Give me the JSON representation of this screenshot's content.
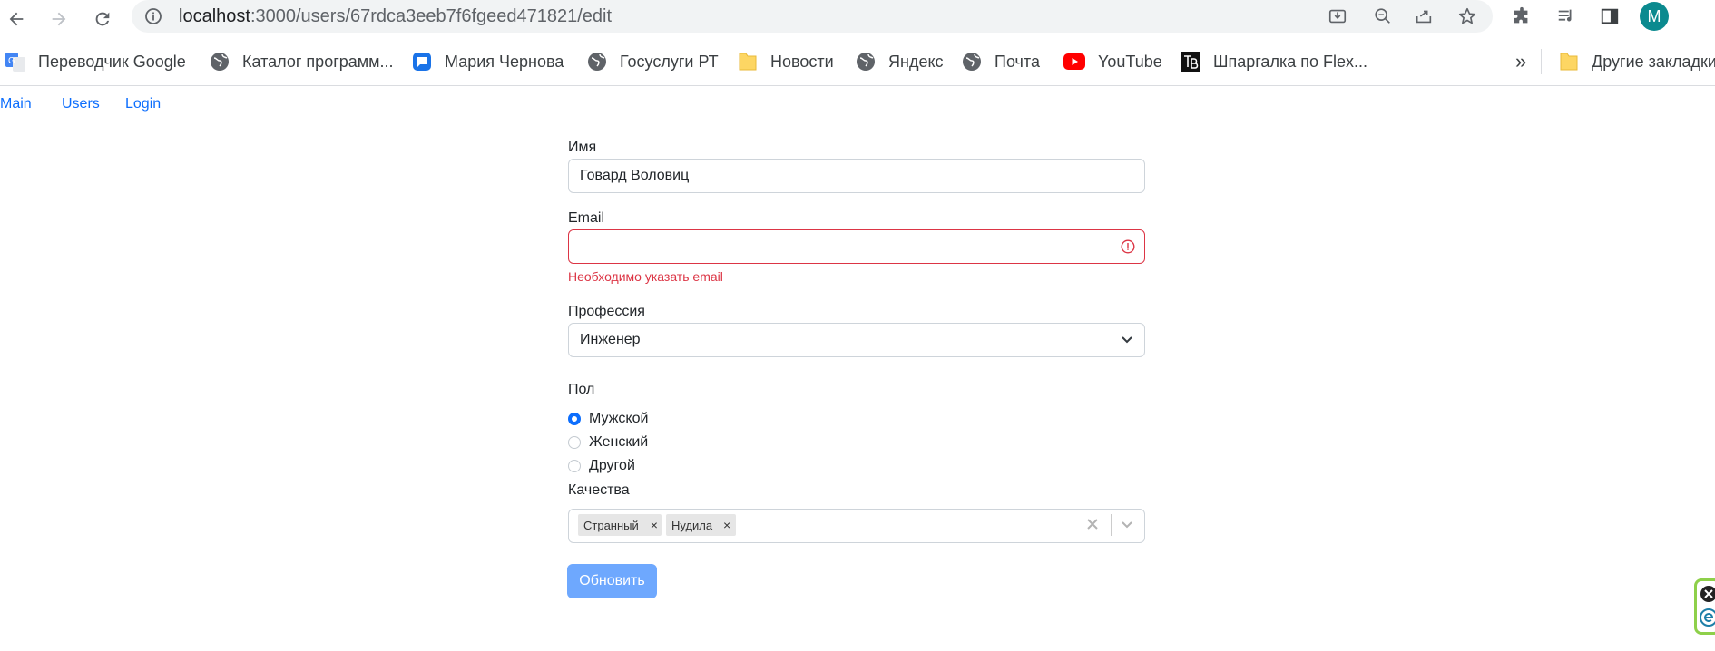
{
  "browser": {
    "url_host": "localhost",
    "url_path": ":3000/users/67rdca3eeb7f6fgeed471821/edit",
    "avatar_letter": "M"
  },
  "bookmarks": {
    "items": [
      {
        "label": "Переводчик Google",
        "icon": "google-translate-icon"
      },
      {
        "label": "Каталог программ...",
        "icon": "globe-icon"
      },
      {
        "label": "Мария Чернова",
        "icon": "chat-icon"
      },
      {
        "label": "Госуслуги РТ",
        "icon": "globe-icon"
      },
      {
        "label": "Новости",
        "icon": "folder-icon"
      },
      {
        "label": "Яндекс",
        "icon": "globe-icon"
      },
      {
        "label": "Почта",
        "icon": "globe-icon"
      },
      {
        "label": "YouTube",
        "icon": "youtube-icon"
      },
      {
        "label": "Шпаргалка по Flex...",
        "icon": "tb-icon"
      }
    ],
    "overflow": "»",
    "other_bookmarks": "Другие закладки"
  },
  "nav": {
    "main": "Main",
    "users": "Users",
    "login": "Login"
  },
  "form": {
    "name_label": "Имя",
    "name_value": "Говард Воловиц",
    "email_label": "Email",
    "email_value": "",
    "email_error": "Необходимо указать email",
    "profession_label": "Профессия",
    "profession_value": "Инженер",
    "sex_label": "Пол",
    "sex_options": [
      "Мужской",
      "Женский",
      "Другой"
    ],
    "sex_selected": "Мужской",
    "qualities_label": "Качества",
    "qualities": [
      "Странный",
      "Нудила"
    ],
    "chip_remove": "×",
    "submit_label": "Обновить"
  },
  "colors": {
    "accent": "#0d6efd",
    "button": "#6ea8fe",
    "error": "#dc3545",
    "avatar": "#0b8a8f"
  }
}
